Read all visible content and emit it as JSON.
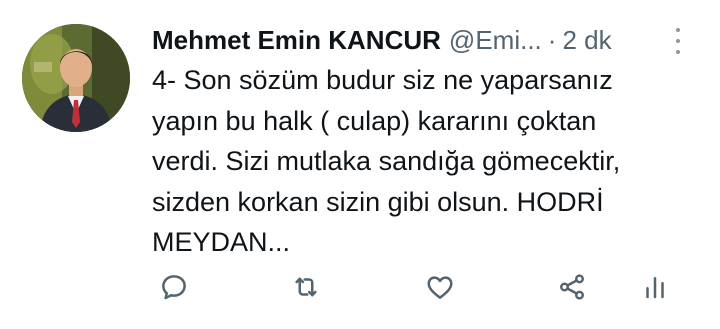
{
  "tweet": {
    "display_name": "Mehmet Emin KANCUR",
    "handle": "@Emi...",
    "separator": "·",
    "time": "2 dk",
    "text": "4-  Son sözüm budur siz ne yaparsanız\nyapın bu halk ( culap) kararını çoktan\nverdi. Sizi mutlaka sandığa gömecektir,\nsizden korkan sizin gibi olsun. HODRİ\nMEYDAN...",
    "avatar_icon": "profile-photo",
    "more_icon": "vertical-dots-icon"
  },
  "actions": [
    {
      "icon": "reply-icon"
    },
    {
      "icon": "retweet-icon"
    },
    {
      "icon": "like-icon"
    },
    {
      "icon": "share-icon"
    },
    {
      "icon": "analytics-icon"
    }
  ],
  "colors": {
    "text": "#0f1419",
    "secondary": "#536471",
    "background": "#ffffff"
  }
}
